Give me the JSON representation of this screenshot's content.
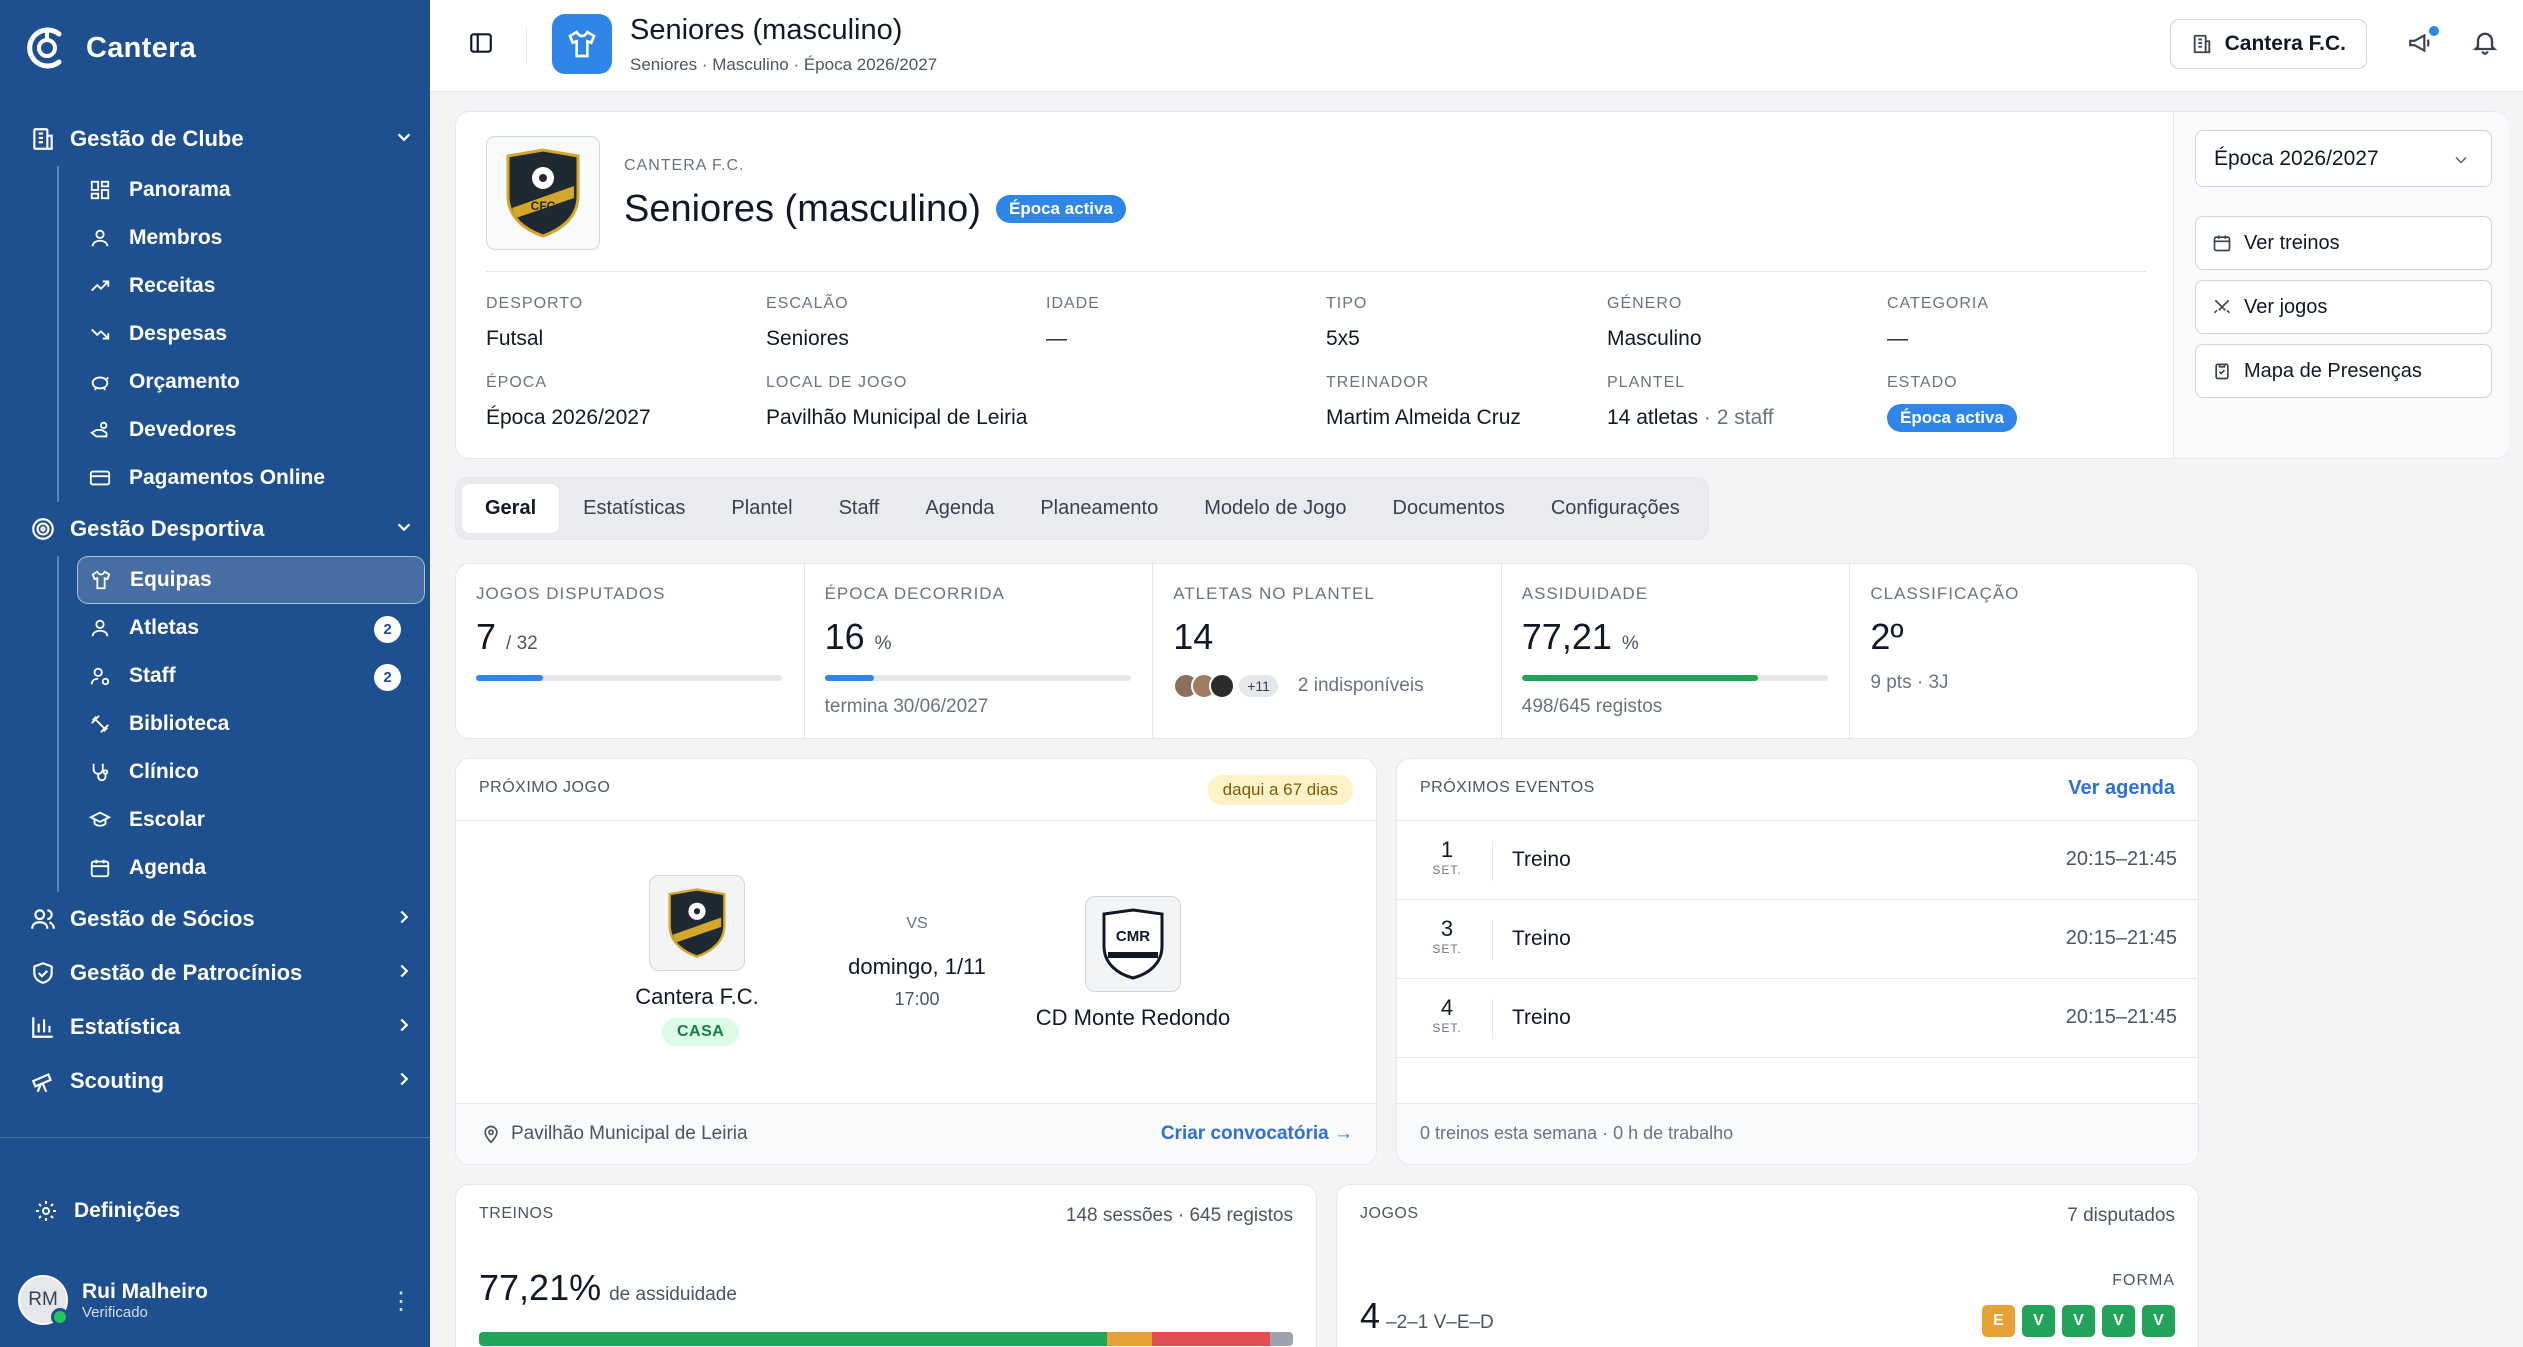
{
  "app": {
    "name": "Cantera"
  },
  "sidebar": {
    "sections": [
      {
        "label": "Gestão de Clube",
        "items": [
          {
            "label": "Panorama"
          },
          {
            "label": "Membros"
          },
          {
            "label": "Receitas"
          },
          {
            "label": "Despesas"
          },
          {
            "label": "Orçamento"
          },
          {
            "label": "Devedores"
          },
          {
            "label": "Pagamentos Online"
          }
        ]
      },
      {
        "label": "Gestão Desportiva",
        "items": [
          {
            "label": "Equipas",
            "active": true
          },
          {
            "label": "Atletas",
            "badge": "2"
          },
          {
            "label": "Staff",
            "badge": "2"
          },
          {
            "label": "Biblioteca"
          },
          {
            "label": "Clínico"
          },
          {
            "label": "Escolar"
          },
          {
            "label": "Agenda"
          }
        ]
      },
      {
        "label": "Gestão de Sócios"
      },
      {
        "label": "Gestão de Patrocínios"
      },
      {
        "label": "Estatística"
      },
      {
        "label": "Scouting"
      }
    ],
    "settings": "Definições",
    "user": {
      "initials": "RM",
      "name": "Rui Malheiro",
      "role": "Verificado"
    }
  },
  "topbar": {
    "title": "Seniores (masculino)",
    "breadcrumb": "Seniores · Masculino · Época 2026/2027",
    "club_button": "Cantera F.C."
  },
  "team": {
    "club": "CANTERA F.C.",
    "title": "Seniores (masculino)",
    "status": "Época activa",
    "crest_text": "CFC",
    "meta": [
      {
        "label": "DESPORTO",
        "value": "Futsal"
      },
      {
        "label": "ESCALÃO",
        "value": "Seniores"
      },
      {
        "label": "IDADE",
        "value": "—"
      },
      {
        "label": "TIPO",
        "value": "5x5"
      },
      {
        "label": "GÉNERO",
        "value": "Masculino"
      },
      {
        "label": "CATEGORIA",
        "value": "—"
      },
      {
        "label": "ÉPOCA",
        "value": "Época 2026/2027"
      },
      {
        "label": "LOCAL DE JOGO",
        "value": "Pavilhão Municipal de Leiria"
      },
      {
        "label": "TREINADOR",
        "value": "Martim Almeida Cruz"
      },
      {
        "label": "PLANTEL",
        "value": "14 atletas",
        "extra": " · 2 staff"
      },
      {
        "label": "ESTADO",
        "value": "Época activa"
      }
    ],
    "season_select": "Época 2026/2027",
    "actions": [
      "Ver treinos",
      "Ver jogos",
      "Mapa de Presenças"
    ]
  },
  "tabs": [
    "Geral",
    "Estatísticas",
    "Plantel",
    "Staff",
    "Agenda",
    "Planeamento",
    "Modelo de Jogo",
    "Documentos",
    "Configurações"
  ],
  "stats": {
    "jogos": {
      "label": "JOGOS DISPUTADOS",
      "value": "7",
      "suffix": "/ 32",
      "progress": 0.22
    },
    "epoca": {
      "label": "ÉPOCA DECORRIDA",
      "value": "16",
      "suffix": "%",
      "progress": 0.16,
      "sub": "termina 30/06/2027"
    },
    "atletas": {
      "label": "ATLETAS NO PLANTEL",
      "value": "14",
      "more": "+11",
      "sub": "2 indisponíveis"
    },
    "assiduidade": {
      "label": "ASSIDUIDADE",
      "value": "77,21",
      "suffix": "%",
      "progress": 0.7721,
      "sub": "498/645 registos"
    },
    "classificacao": {
      "label": "CLASSIFICAÇÃO",
      "value": "2º",
      "sub": "9 pts · 3J"
    }
  },
  "next_game": {
    "header": "PRÓXIMO JOGO",
    "countdown": "daqui a 67 dias",
    "home": "Cantera F.C.",
    "home_tag": "CASA",
    "vs": "VS",
    "date": "domingo, 1/11",
    "time": "17:00",
    "away": "CD Monte Redondo",
    "away_crest": "CMR",
    "venue": "Pavilhão Municipal de Leiria",
    "action": "Criar convocatória →"
  },
  "events": {
    "header": "PRÓXIMOS EVENTOS",
    "link": "Ver agenda",
    "items": [
      {
        "day": "1",
        "month": "SET.",
        "name": "Treino",
        "time": "20:15–21:45"
      },
      {
        "day": "3",
        "month": "SET.",
        "name": "Treino",
        "time": "20:15–21:45"
      },
      {
        "day": "4",
        "month": "SET.",
        "name": "Treino",
        "time": "20:15–21:45"
      }
    ],
    "footer": "0 treinos esta semana · 0 h de trabalho"
  },
  "training": {
    "header": "TREINOS",
    "summary": "148 sessões · 645 registos",
    "value": "77,21%",
    "caption": "de assiduidade",
    "segments": [
      {
        "share": 0.772,
        "color": "#22a35a"
      },
      {
        "share": 0.055,
        "color": "#e5a136"
      },
      {
        "share": 0.145,
        "color": "#e04f4f"
      },
      {
        "share": 0.028,
        "color": "#9ca3af"
      }
    ]
  },
  "games": {
    "header": "JOGOS",
    "summary": "7 disputados",
    "record": "4",
    "record_detail": "–2–1  V–E–D",
    "form_label": "FORMA",
    "form": [
      {
        "r": "E",
        "color": "#e5a136"
      },
      {
        "r": "V",
        "color": "#22a35a"
      },
      {
        "r": "V",
        "color": "#22a35a"
      },
      {
        "r": "V",
        "color": "#22a35a"
      },
      {
        "r": "V",
        "color": "#22a35a"
      }
    ]
  },
  "colors": {
    "sidebar": "#1e4f8f",
    "accent": "#2f86e8",
    "success": "#22a35a"
  }
}
